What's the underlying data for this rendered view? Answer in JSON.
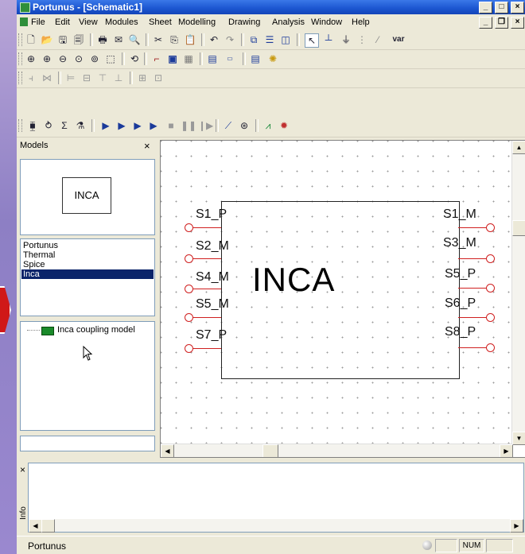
{
  "window": {
    "title": "Portunus - [Schematic1]",
    "controls": {
      "minimize": "_",
      "maximize": "□",
      "close": "×"
    },
    "doc_controls": {
      "minimize": "_",
      "restore": "❐",
      "close": "×"
    }
  },
  "menubar": [
    "File",
    "Edit",
    "View",
    "Modules",
    "Sheet",
    "Modelling",
    "Drawing",
    "Analysis",
    "Window",
    "Help"
  ],
  "toolbars": {
    "row1_right_label": "var"
  },
  "models_panel": {
    "title": "Models",
    "close": "×",
    "preview_label": "INCA",
    "libraries": [
      "Portunus",
      "Thermal",
      "Spice",
      "Inca"
    ],
    "selected_library": "Inca",
    "tree_items": [
      "Inca coupling model"
    ]
  },
  "schematic": {
    "component_label": "INCA",
    "pins_left": [
      "S1_P",
      "S2_M",
      "S4_M",
      "S5_M",
      "S7_P"
    ],
    "pins_right": [
      "S1_M",
      "S3_M",
      "S5_P",
      "S6_P",
      "S8_P"
    ],
    "wire_color": "#d02020"
  },
  "info_panel": {
    "close": "×",
    "side_label": "Info"
  },
  "statusbar": {
    "app_name": "Portunus",
    "num_indicator": "NUM"
  }
}
